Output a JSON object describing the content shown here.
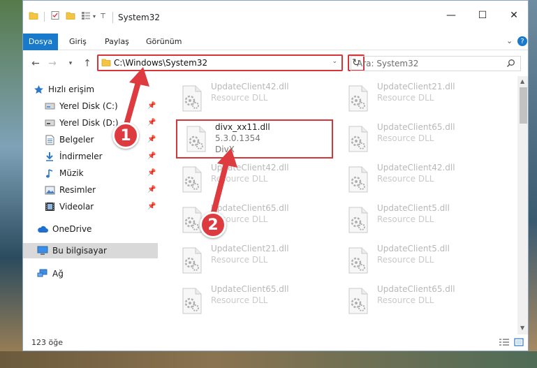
{
  "window": {
    "title": "System32",
    "controls": {
      "minimize": "—",
      "maximize": "☐",
      "close": "✕"
    }
  },
  "ribbon": {
    "tabs": [
      {
        "label": "Dosya"
      },
      {
        "label": "Giriş"
      },
      {
        "label": "Paylaş"
      },
      {
        "label": "Görünüm"
      }
    ],
    "help": "?"
  },
  "nav": {
    "address": "C:\\Windows\\System32",
    "search_placeholder": "Ara: System32"
  },
  "sidebar": {
    "quick_access": "Hızlı erişim",
    "items": [
      {
        "label": "Yerel Disk (C:)",
        "icon": "drive-icon",
        "pinned": true
      },
      {
        "label": "Yerel Disk (D:)",
        "icon": "drive-icon",
        "pinned": true
      },
      {
        "label": "Belgeler",
        "icon": "documents-icon",
        "pinned": true
      },
      {
        "label": "İndirmeler",
        "icon": "download-icon",
        "pinned": true
      },
      {
        "label": "Müzik",
        "icon": "music-icon",
        "pinned": true
      },
      {
        "label": "Resimler",
        "icon": "pictures-icon",
        "pinned": true
      },
      {
        "label": "Videolar",
        "icon": "video-icon",
        "pinned": true
      }
    ],
    "onedrive": "OneDrive",
    "this_pc": "Bu bilgisayar",
    "network": "Ağ"
  },
  "files": {
    "left": [
      {
        "name": "UpdateClient42.dll",
        "desc": "Resource DLL"
      },
      {
        "name": "divx_xx11.dll",
        "version": "5.3.0.1354",
        "desc": "DivX"
      },
      {
        "name": "UpdateClient42.dll",
        "desc": "Resource DLL"
      },
      {
        "name": "UpdateClient65.dll",
        "desc": "Resource DLL"
      },
      {
        "name": "UpdateClient21.dll",
        "desc": "Resource DLL"
      },
      {
        "name": "UpdateClient65.dll",
        "desc": "Resource DLL"
      }
    ],
    "right": [
      {
        "name": "UpdateClient21.dll",
        "desc": "Resource DLL"
      },
      {
        "name": "UpdateClient65.dll",
        "desc": "Resource DLL"
      },
      {
        "name": "UpdateClient42.dll",
        "desc": "Resource DLL"
      },
      {
        "name": "UpdateClient5.dll",
        "desc": "Resource DLL"
      },
      {
        "name": "UpdateClient5.dll",
        "desc": "Resource DLL"
      },
      {
        "name": "UpdateClient65.dll",
        "desc": "Resource DLL"
      }
    ]
  },
  "status": {
    "count": "123 öğe"
  },
  "annotations": {
    "step1": "1",
    "step2": "2",
    "color": "#dd3b3f"
  }
}
